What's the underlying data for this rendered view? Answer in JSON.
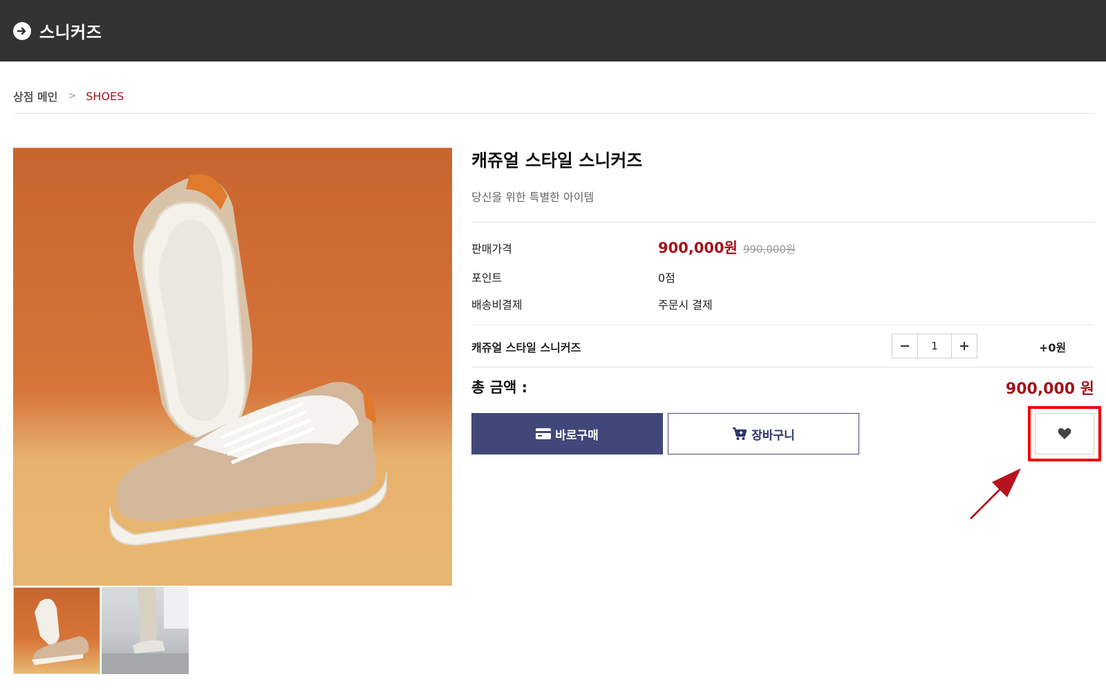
{
  "header": {
    "title": "스니커즈",
    "back_icon": "arrow-circle-right-icon"
  },
  "breadcrumb": {
    "home": "상점 메인",
    "separator": ">",
    "current": "SHOES"
  },
  "product": {
    "title": "캐쥬얼 스타일 스니커즈",
    "subtitle": "당신을 위한 특별한 아이템",
    "info": {
      "price_label": "판매가격",
      "sale_price": "900,000원",
      "original_price": "990,000원",
      "points_label": "포인트",
      "points_value": "0점",
      "shipping_label": "배송비결제",
      "shipping_value": "주문시 결제"
    },
    "option": {
      "name": "캐쥬얼 스타일 스니커즈",
      "quantity": "1",
      "extra_price": "+0원"
    },
    "total": {
      "label": "총 금액 :",
      "value": "900,000 원"
    },
    "buttons": {
      "buy": "바로구매",
      "cart": "장바구니"
    }
  },
  "colors": {
    "accent_red": "#a3141a",
    "button_navy": "#42477a",
    "header_bg": "#333333",
    "highlight": "#ee0000"
  }
}
